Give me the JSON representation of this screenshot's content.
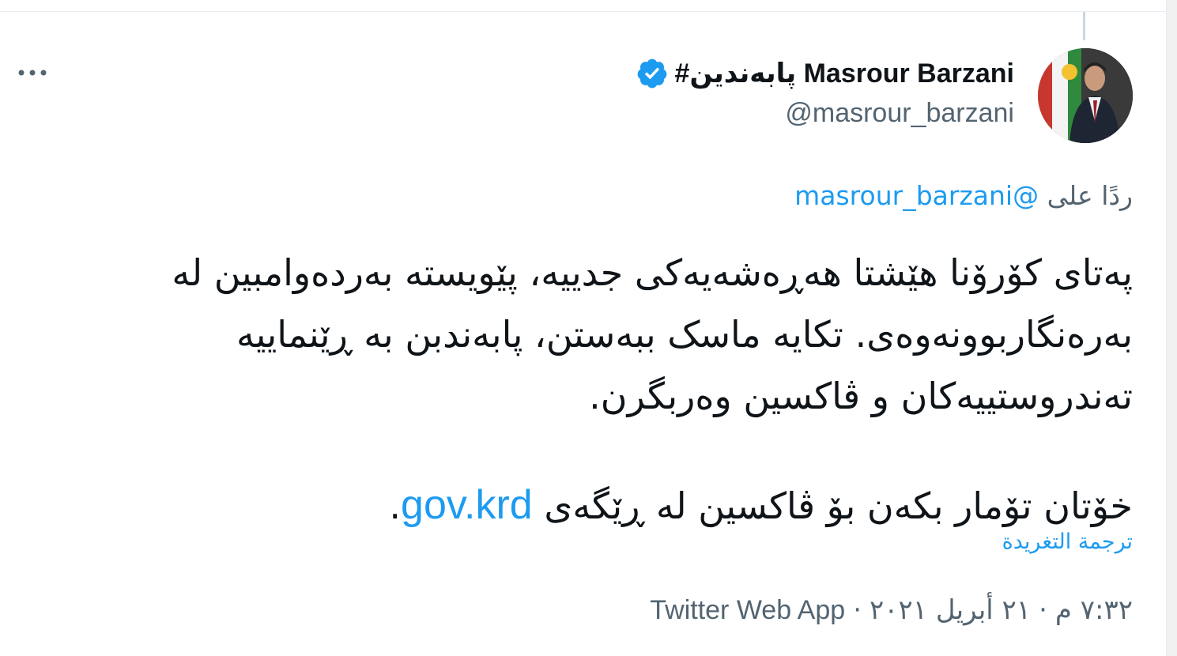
{
  "tweet": {
    "author": {
      "display_name": "#پابەندین Masrour Barzani",
      "handle": "@masrour_barzani",
      "verified": true,
      "avatar": "profile-photo"
    },
    "reply_prefix": "ردًا على",
    "reply_to": "@masrour_barzani",
    "text_lines": [
      "پەتای کۆرۆنا هێشتا هەڕەشەیەکی جدییە، پێویستە بەردەوامبین لە بەرەنگاربوونەوەی. تکایە ماسک ببەستن، پابەندبن بە ڕێنماییە تەندروستییەکان و ڤاکسین وەربگرن."
    ],
    "text_line2_before_link": "خۆتان تۆمار بکەن بۆ ڤاکسین لە ڕێگەی",
    "link_text": "gov.krd",
    "text_line2_after_link": ".",
    "translate_label": "ترجمة التغريدة",
    "time": "٧:٣٢ م",
    "date": "٢١ أبريل ٢٠٢١",
    "separator": "·",
    "source": "Twitter Web App",
    "more_icon": "more-horizontal-icon",
    "verified_icon": "verified-badge-icon"
  },
  "colors": {
    "link": "#1d9bf0",
    "text": "#0f1419",
    "secondary": "#536471",
    "border": "#e6ecf0"
  }
}
